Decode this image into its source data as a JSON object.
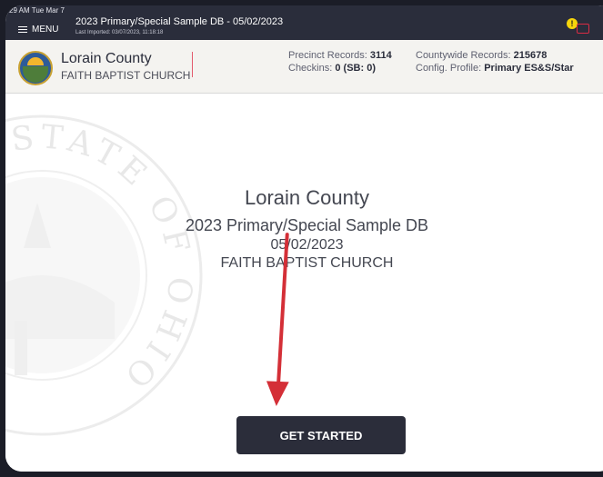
{
  "status": {
    "time": "29 AM  Tue Mar 7"
  },
  "topbar": {
    "menu_label": "MENU",
    "db_title": "2023 Primary/Special Sample DB - 05/02/2023",
    "last_imported": "Last Imported: 03/07/2023, 11:18:18",
    "alert_text": "!"
  },
  "infobar": {
    "county": "Lorain County",
    "church": "FAITH BAPTIST CHURCH",
    "precinct_label": "Precinct Records:",
    "precinct_value": "3114",
    "checkins_label": "Checkins:",
    "checkins_value": "0 (SB: 0)",
    "countywide_label": "Countywide Records:",
    "countywide_value": "215678",
    "profile_label": "Config. Profile:",
    "profile_value": "Primary ES&S/Star"
  },
  "main": {
    "county": "Lorain County",
    "db_name": "2023 Primary/Special Sample DB",
    "date": "05/02/2023",
    "church": "FAITH BAPTIST CHURCH",
    "button_label": "GET STARTED"
  },
  "watermark": {
    "text": "THE STATE OF OHIO"
  },
  "colors": {
    "topbar": "#2a2d3b",
    "button": "#2b2d3a",
    "arrow": "#d42f37",
    "alert": "#f6d50b"
  }
}
